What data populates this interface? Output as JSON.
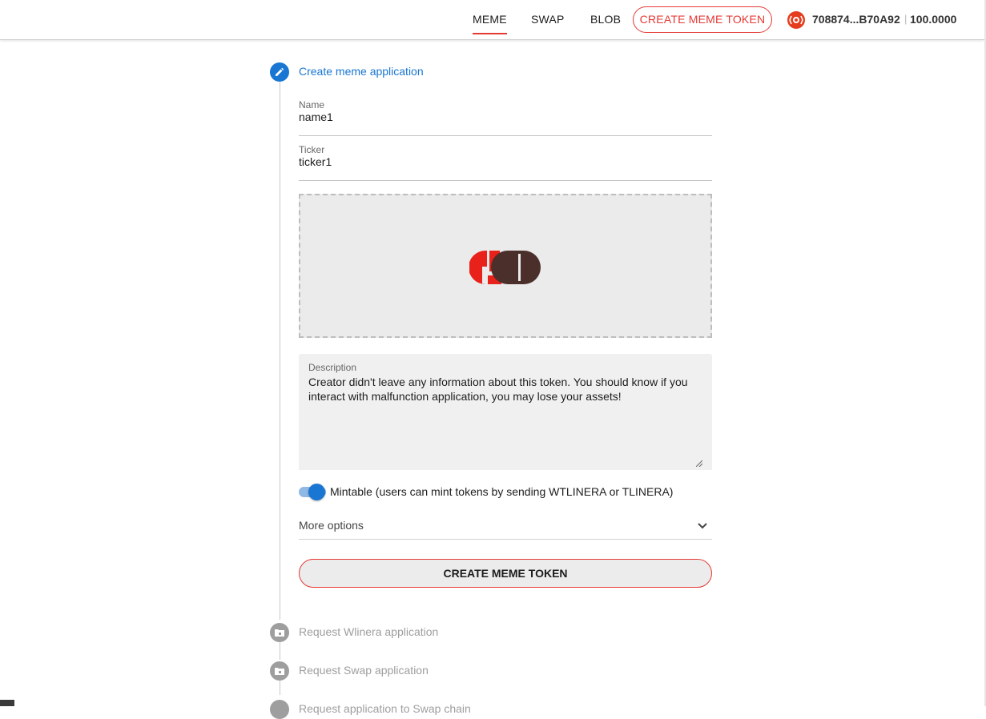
{
  "header": {
    "nav": [
      {
        "label": "MEME",
        "active": true
      },
      {
        "label": "SWAP",
        "active": false
      },
      {
        "label": "BLOB",
        "active": false
      }
    ],
    "create_button": "CREATE MEME TOKEN",
    "wallet": {
      "icon": "linera-logo-icon",
      "address": "708874...B70A92",
      "separator": "|",
      "balance": "100.0000"
    }
  },
  "stepper": {
    "steps": [
      {
        "title": "Create meme application",
        "state": "active",
        "icon": "pencil-icon"
      },
      {
        "title": "Request Wlinera application",
        "state": "pending",
        "icon": "folder-icon"
      },
      {
        "title": "Request Swap application",
        "state": "pending",
        "icon": "folder-icon"
      },
      {
        "title": "Request application to Swap chain",
        "state": "pending",
        "icon": "folder-icon"
      }
    ]
  },
  "form": {
    "name": {
      "label": "Name",
      "value": "name1"
    },
    "ticker": {
      "label": "Ticker",
      "value": "ticker1"
    },
    "image": {
      "logo_icon": "meme-logo-icon"
    },
    "description": {
      "label": "Description",
      "value": "Creator didn't leave any information about this token. You should know if you interact with malfunction application, you may lose your assets!"
    },
    "mintable": {
      "checked": true,
      "label": "Mintable (users can mint tokens by sending WTLINERA or TLINERA)"
    },
    "more_options": "More options",
    "submit": "CREATE MEME TOKEN"
  },
  "colors": {
    "accent_red": "#e53935",
    "primary_blue": "#1976d2",
    "inactive_grey": "#9e9e9e"
  }
}
